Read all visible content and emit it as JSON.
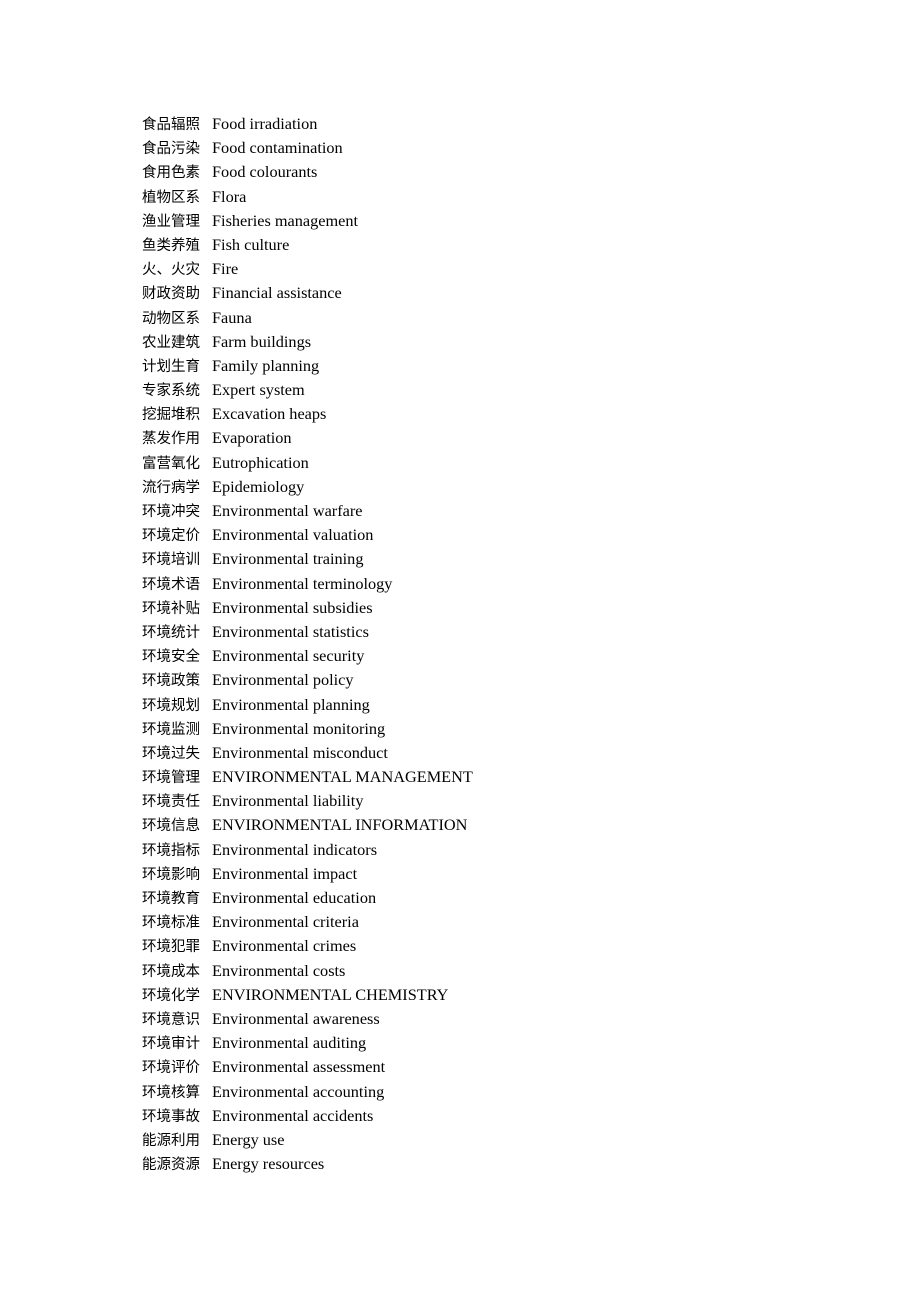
{
  "document": {
    "type": "bilingual-glossary",
    "page_background": "#ffffff",
    "text_color": "#000000",
    "entries": [
      {
        "zh": "食品辐照",
        "en": "Food irradiation"
      },
      {
        "zh": "食品污染",
        "en": "Food contamination"
      },
      {
        "zh": "食用色素",
        "en": "Food colourants"
      },
      {
        "zh": "植物区系",
        "en": "Flora"
      },
      {
        "zh": "渔业管理",
        "en": "Fisheries management"
      },
      {
        "zh": "鱼类养殖",
        "en": "Fish culture"
      },
      {
        "zh": "火、火灾",
        "en": "Fire"
      },
      {
        "zh": "财政资助",
        "en": "Financial assistance"
      },
      {
        "zh": "动物区系",
        "en": "Fauna"
      },
      {
        "zh": "农业建筑",
        "en": "Farm buildings"
      },
      {
        "zh": "计划生育",
        "en": "Family planning"
      },
      {
        "zh": "专家系统",
        "en": "Expert system"
      },
      {
        "zh": "挖掘堆积",
        "en": "Excavation heaps"
      },
      {
        "zh": "蒸发作用",
        "en": "Evaporation"
      },
      {
        "zh": "富营氧化",
        "en": "Eutrophication"
      },
      {
        "zh": "流行病学",
        "en": "Epidemiology"
      },
      {
        "zh": "环境冲突",
        "en": "Environmental warfare"
      },
      {
        "zh": "环境定价",
        "en": "Environmental valuation"
      },
      {
        "zh": "环境培训",
        "en": "Environmental training"
      },
      {
        "zh": "环境术语",
        "en": "Environmental terminology"
      },
      {
        "zh": "环境补贴",
        "en": "Environmental subsidies"
      },
      {
        "zh": "环境统计",
        "en": "Environmental statistics"
      },
      {
        "zh": "环境安全",
        "en": "Environmental security"
      },
      {
        "zh": "环境政策",
        "en": "Environmental policy"
      },
      {
        "zh": "环境规划",
        "en": "Environmental planning"
      },
      {
        "zh": "环境监测",
        "en": "Environmental monitoring"
      },
      {
        "zh": "环境过失",
        "en": "Environmental misconduct"
      },
      {
        "zh": "环境管理",
        "en": "ENVIRONMENTAL MANAGEMENT"
      },
      {
        "zh": "环境责任",
        "en": "Environmental liability"
      },
      {
        "zh": "环境信息",
        "en": "ENVIRONMENTAL INFORMATION"
      },
      {
        "zh": "环境指标",
        "en": "Environmental indicators"
      },
      {
        "zh": "环境影响",
        "en": "Environmental impact"
      },
      {
        "zh": "环境教育",
        "en": "Environmental education"
      },
      {
        "zh": "环境标准",
        "en": "Environmental criteria"
      },
      {
        "zh": "环境犯罪",
        "en": "Environmental crimes"
      },
      {
        "zh": "环境成本",
        "en": "Environmental costs"
      },
      {
        "zh": "环境化学",
        "en": "ENVIRONMENTAL CHEMISTRY"
      },
      {
        "zh": "环境意识",
        "en": "Environmental awareness"
      },
      {
        "zh": "环境审计",
        "en": "Environmental auditing"
      },
      {
        "zh": "环境评价",
        "en": "Environmental assessment"
      },
      {
        "zh": "环境核算",
        "en": "Environmental accounting"
      },
      {
        "zh": "环境事故",
        "en": "Environmental accidents"
      },
      {
        "zh": "能源利用",
        "en": "Energy use"
      },
      {
        "zh": "能源资源",
        "en": "Energy resources"
      }
    ]
  }
}
